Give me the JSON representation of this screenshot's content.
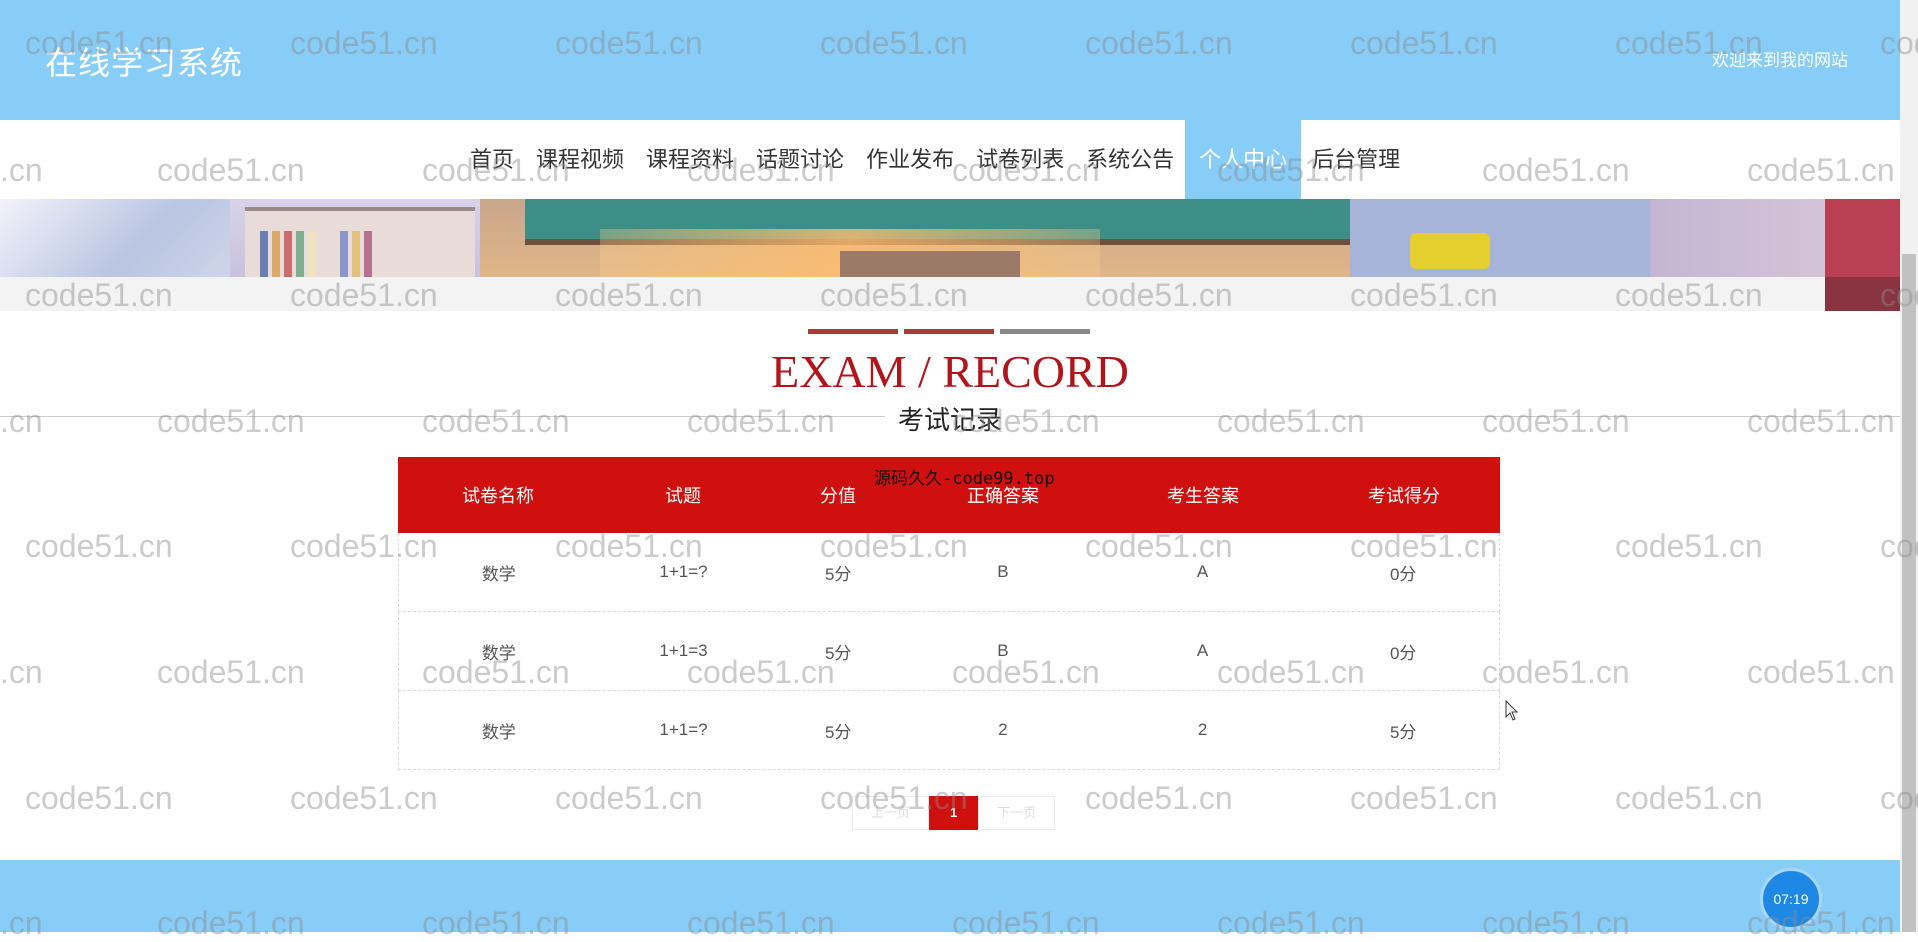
{
  "header": {
    "site_title": "在线学习系统",
    "welcome": "欢迎来到我的网站"
  },
  "nav": {
    "items": [
      "首页",
      "课程视频",
      "课程资料",
      "话题讨论",
      "作业发布",
      "试卷列表",
      "系统公告",
      "个人中心",
      "后台管理"
    ],
    "active": "个人中心"
  },
  "section": {
    "title": "EXAM / RECORD",
    "subtitle": "考试记录",
    "bar_colors": [
      "#a83a3a",
      "#a83a3a",
      "#888888"
    ]
  },
  "table": {
    "headers": [
      "试卷名称",
      "试题",
      "分值",
      "正确答案",
      "考生答案",
      "考试得分"
    ],
    "rows": [
      [
        "数学",
        "1+1=?",
        "5分",
        "B",
        "A",
        "0分"
      ],
      [
        "数学",
        "1+1=3",
        "5分",
        "B",
        "A",
        "0分"
      ],
      [
        "数学",
        "1+1=?",
        "5分",
        "2",
        "2",
        "5分"
      ]
    ]
  },
  "overlay_text": "源码久久-code99.top",
  "pagination": {
    "prev": "上一页",
    "current": "1",
    "next": "下一页"
  },
  "clock": "07:19",
  "watermark": "code51.cn",
  "colors": {
    "header_bg": "#87cdf7",
    "accent_red": "#d0100f",
    "title_red": "#b1151b"
  }
}
